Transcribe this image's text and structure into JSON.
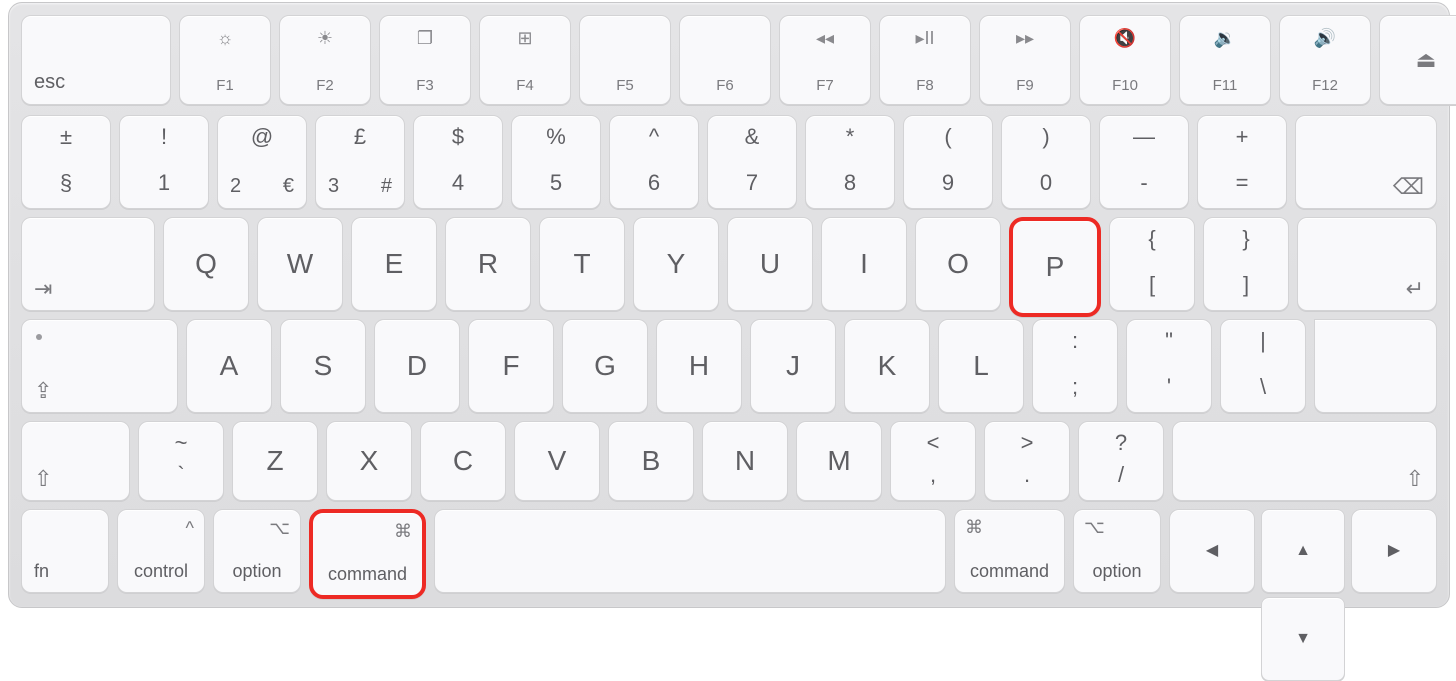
{
  "row0": {
    "esc": "esc",
    "fkeys": [
      {
        "name": "f1",
        "label": "F1",
        "icon": "☼"
      },
      {
        "name": "f2",
        "label": "F2",
        "icon": "☀"
      },
      {
        "name": "f3",
        "label": "F3",
        "icon": "❐"
      },
      {
        "name": "f4",
        "label": "F4",
        "icon": "⊞"
      },
      {
        "name": "f5",
        "label": "F5",
        "icon": ""
      },
      {
        "name": "f6",
        "label": "F6",
        "icon": ""
      },
      {
        "name": "f7",
        "label": "F7",
        "icon": "◂◂"
      },
      {
        "name": "f8",
        "label": "F8",
        "icon": "▸II"
      },
      {
        "name": "f9",
        "label": "F9",
        "icon": "▸▸"
      },
      {
        "name": "f10",
        "label": "F10",
        "icon": "🔇"
      },
      {
        "name": "f11",
        "label": "F11",
        "icon": "🔉"
      },
      {
        "name": "f12",
        "label": "F12",
        "icon": "🔊"
      }
    ],
    "eject": "⏏"
  },
  "row1": [
    {
      "name": "section",
      "tl": "±",
      "bl": "§"
    },
    {
      "name": "1",
      "tl": "!",
      "bc": "1"
    },
    {
      "name": "2",
      "tl": "@",
      "bc": "2",
      "br": "€"
    },
    {
      "name": "3",
      "tl": "£",
      "bc": "3",
      "br": "#"
    },
    {
      "name": "4",
      "tl": "$",
      "bc": "4"
    },
    {
      "name": "5",
      "tl": "%",
      "bc": "5"
    },
    {
      "name": "6",
      "tl": "^",
      "bc": "6"
    },
    {
      "name": "7",
      "tl": "&",
      "bc": "7"
    },
    {
      "name": "8",
      "tl": "*",
      "bc": "8"
    },
    {
      "name": "9",
      "tl": "(",
      "bc": "9"
    },
    {
      "name": "0",
      "tl": ")",
      "bc": "0"
    },
    {
      "name": "minus",
      "tl": "—",
      "bc": "-"
    },
    {
      "name": "equal",
      "tl": "+",
      "bc": "="
    }
  ],
  "backspace": "⌫",
  "tab": "⇥",
  "row2": [
    "Q",
    "W",
    "E",
    "R",
    "T",
    "Y",
    "U",
    "I",
    "O",
    "P"
  ],
  "bracketL": {
    "tl": "{",
    "bc": "["
  },
  "bracketR": {
    "tl": "}",
    "bc": "]"
  },
  "enter": "↵",
  "caps": "⇪",
  "row3": [
    "A",
    "S",
    "D",
    "F",
    "G",
    "H",
    "J",
    "K",
    "L"
  ],
  "semicolon": {
    "tl": ":",
    "bc": ";"
  },
  "quote": {
    "tl": "\"",
    "bc": "'"
  },
  "backslash": {
    "tl": "|",
    "bc": "\\"
  },
  "shift": "⇧",
  "tilde": {
    "tl": "~",
    "bc": "`"
  },
  "row4": [
    "Z",
    "X",
    "C",
    "V",
    "B",
    "N",
    "M"
  ],
  "comma": {
    "tl": "<",
    "bc": ","
  },
  "period": {
    "tl": ">",
    "bc": "."
  },
  "slash": {
    "tl": "?",
    "bc": "/"
  },
  "bottom": {
    "fn": "fn",
    "control": "control",
    "option": "option",
    "command": "command",
    "ctrlGlyph": "^",
    "optGlyph": "⌥",
    "cmdGlyph": "⌘"
  },
  "arrows": {
    "left": "◀",
    "up": "▲",
    "down": "▼",
    "right": "▶"
  },
  "highlight": [
    "p-key",
    "left-command-key"
  ]
}
